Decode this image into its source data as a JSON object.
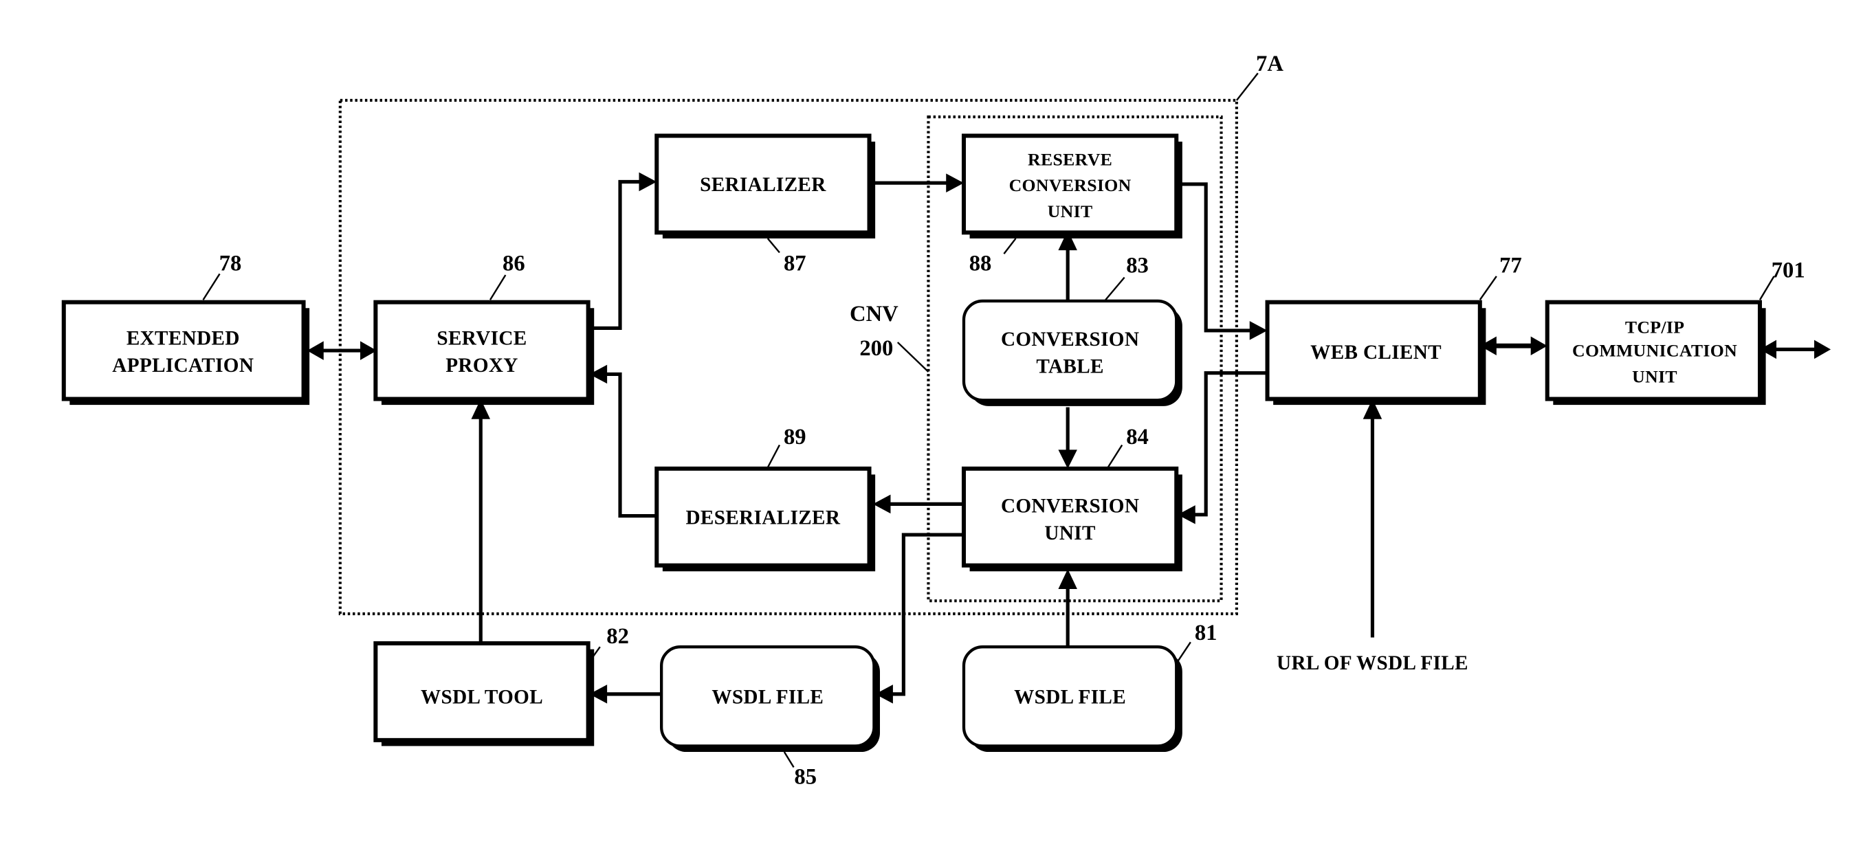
{
  "diagram": {
    "container_label": "7A",
    "cnv_label_line1": "CNV",
    "cnv_label_line2": "200",
    "blocks": {
      "extended_application": {
        "ref": "78",
        "lines": [
          "EXTENDED",
          "APPLICATION"
        ]
      },
      "service_proxy": {
        "ref": "86",
        "lines": [
          "SERVICE",
          "PROXY"
        ]
      },
      "serializer": {
        "ref": "87",
        "lines": [
          "SERIALIZER"
        ]
      },
      "reserve_conversion_unit": {
        "ref": "88",
        "lines": [
          "RESERVE",
          "CONVERSION",
          "UNIT"
        ]
      },
      "conversion_table": {
        "ref": "83",
        "lines": [
          "CONVERSION",
          "TABLE"
        ]
      },
      "web_client": {
        "ref": "77",
        "lines": [
          "WEB CLIENT"
        ]
      },
      "tcpip_unit": {
        "ref": "701",
        "lines": [
          "TCP/IP",
          "COMMUNICATION",
          "UNIT"
        ]
      },
      "deserializer": {
        "ref": "89",
        "lines": [
          "DESERIALIZER"
        ]
      },
      "conversion_unit": {
        "ref": "84",
        "lines": [
          "CONVERSION",
          "UNIT"
        ]
      },
      "wsdl_tool": {
        "ref": "82",
        "lines": [
          "WSDL TOOL"
        ]
      },
      "wsdl_file_generated": {
        "ref": "85",
        "lines": [
          "WSDL FILE"
        ]
      },
      "wsdl_file_input": {
        "ref": "81",
        "lines": [
          "WSDL FILE"
        ]
      }
    },
    "url_label": "URL OF WSDL FILE"
  }
}
